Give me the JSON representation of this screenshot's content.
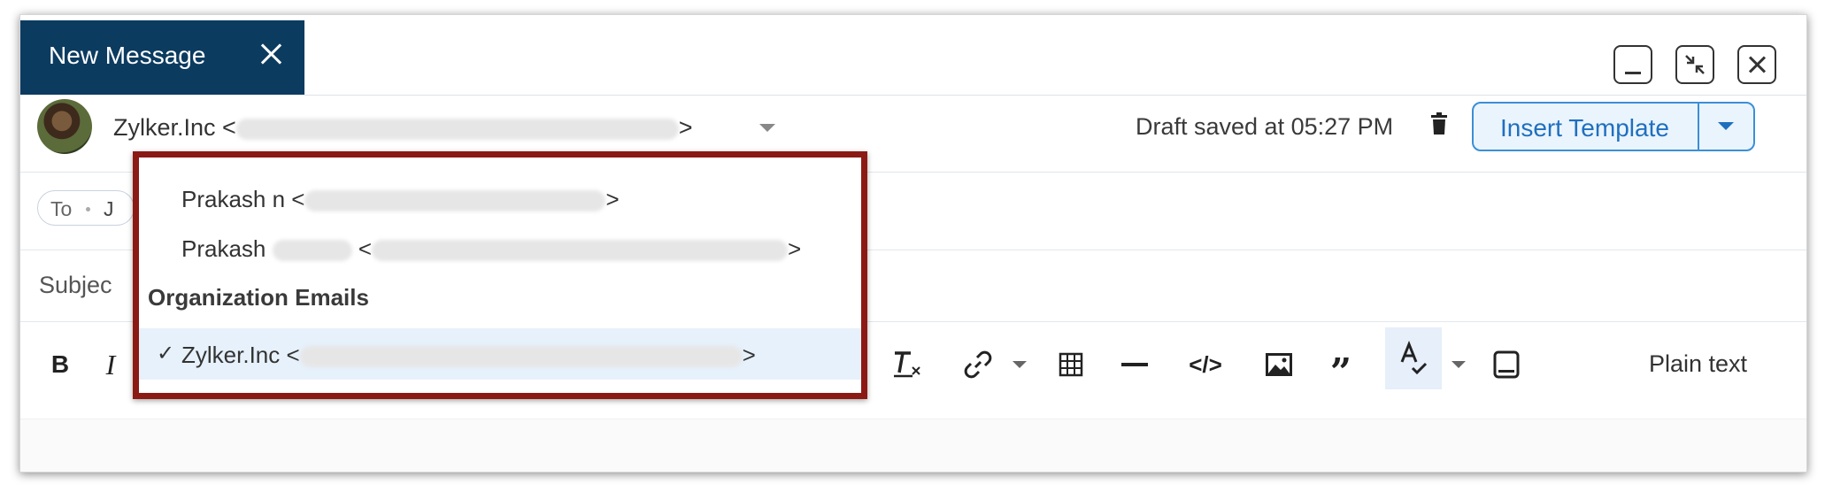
{
  "compose": {
    "tab_title": "New Message",
    "from": {
      "name": "Zylker.Inc <",
      "close": ">"
    },
    "draft_status": "Draft saved at 05:27 PM",
    "insert_template_label": "Insert Template",
    "to_label": "To",
    "to_value_partial": "J",
    "subject_partial": "Subjec"
  },
  "from_dropdown": {
    "items": [
      {
        "name": "Prakash n <",
        "close": ">"
      },
      {
        "name": "Prakash",
        "close": ">"
      }
    ],
    "section_header": "Organization Emails",
    "selected": {
      "name": "Zylker.Inc <",
      "close": ">",
      "check": "✓"
    }
  },
  "toolbar": {
    "bold": "B",
    "italic": "I",
    "code": "</>",
    "quote": "”",
    "plain_text": "Plain text"
  },
  "icons": [
    "close-icon",
    "minimize-icon",
    "shrink-icon",
    "trash-icon",
    "clear-format-icon",
    "link-icon",
    "table-icon",
    "horizontal-line-icon",
    "code-icon",
    "image-icon",
    "quote-icon",
    "spellcheck-icon",
    "snippet-icon"
  ],
  "colors": {
    "tab_bg": "#0c3b60",
    "accent": "#3b8fd6",
    "dropdown_border": "#8b1a14",
    "selected_bg": "#e7f1fb"
  }
}
